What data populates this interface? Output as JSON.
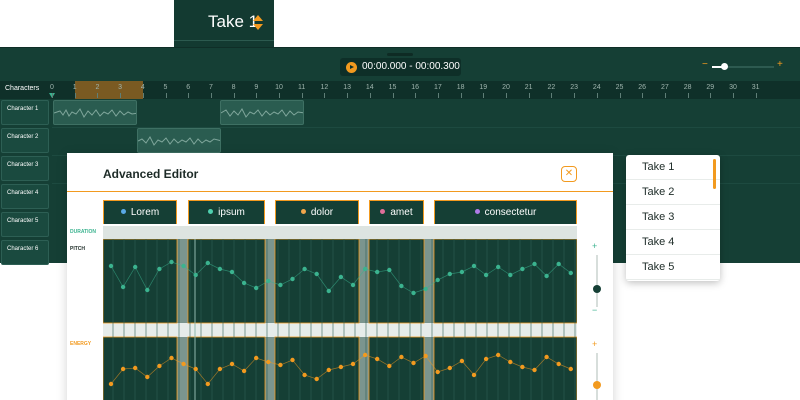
{
  "take_selector": {
    "label": "Take 1",
    "icon": "sort-arrows-icon"
  },
  "toolbar": {
    "time_range": "00:00.000 - 00:00.300",
    "zoom_minus": "−",
    "zoom_plus": "+",
    "zoom_level": 0.2
  },
  "ruler": {
    "label": "Characters",
    "ticks": [
      "0",
      "1",
      "2",
      "3",
      "4",
      "5",
      "6",
      "7",
      "8",
      "9",
      "10",
      "11",
      "12",
      "13",
      "14",
      "15",
      "16",
      "17",
      "18",
      "19",
      "20",
      "21",
      "22",
      "23",
      "24",
      "25",
      "26",
      "27",
      "28",
      "29",
      "30",
      "31"
    ]
  },
  "characters": [
    "Character 1",
    "Character 2",
    "Character 3",
    "Character 4",
    "Character 5",
    "Character 6"
  ],
  "editor": {
    "title": "Advanced Editor",
    "close_icon": "close-icon",
    "words": [
      {
        "text": "Lorem",
        "dot": "#5aa9e6"
      },
      {
        "text": "ipsum",
        "dot": "#4fd1b0"
      },
      {
        "text": "dolor",
        "dot": "#f2a64b"
      },
      {
        "text": "amet",
        "dot": "#e06f9a"
      },
      {
        "text": "consectetur",
        "dot": "#b07be8"
      }
    ],
    "duration_label": "DURATION",
    "pitch_label": "PITCH",
    "energy_label": "ENERGY",
    "scroll_plus": "+",
    "scroll_minus": "−"
  },
  "take_menu": {
    "items": [
      "Take 1",
      "Take 2",
      "Take 3",
      "Take 4",
      "Take 5"
    ]
  },
  "colors": {
    "accent": "#f29a1f",
    "dark_green": "#153f35",
    "teal": "#3bb38f"
  }
}
